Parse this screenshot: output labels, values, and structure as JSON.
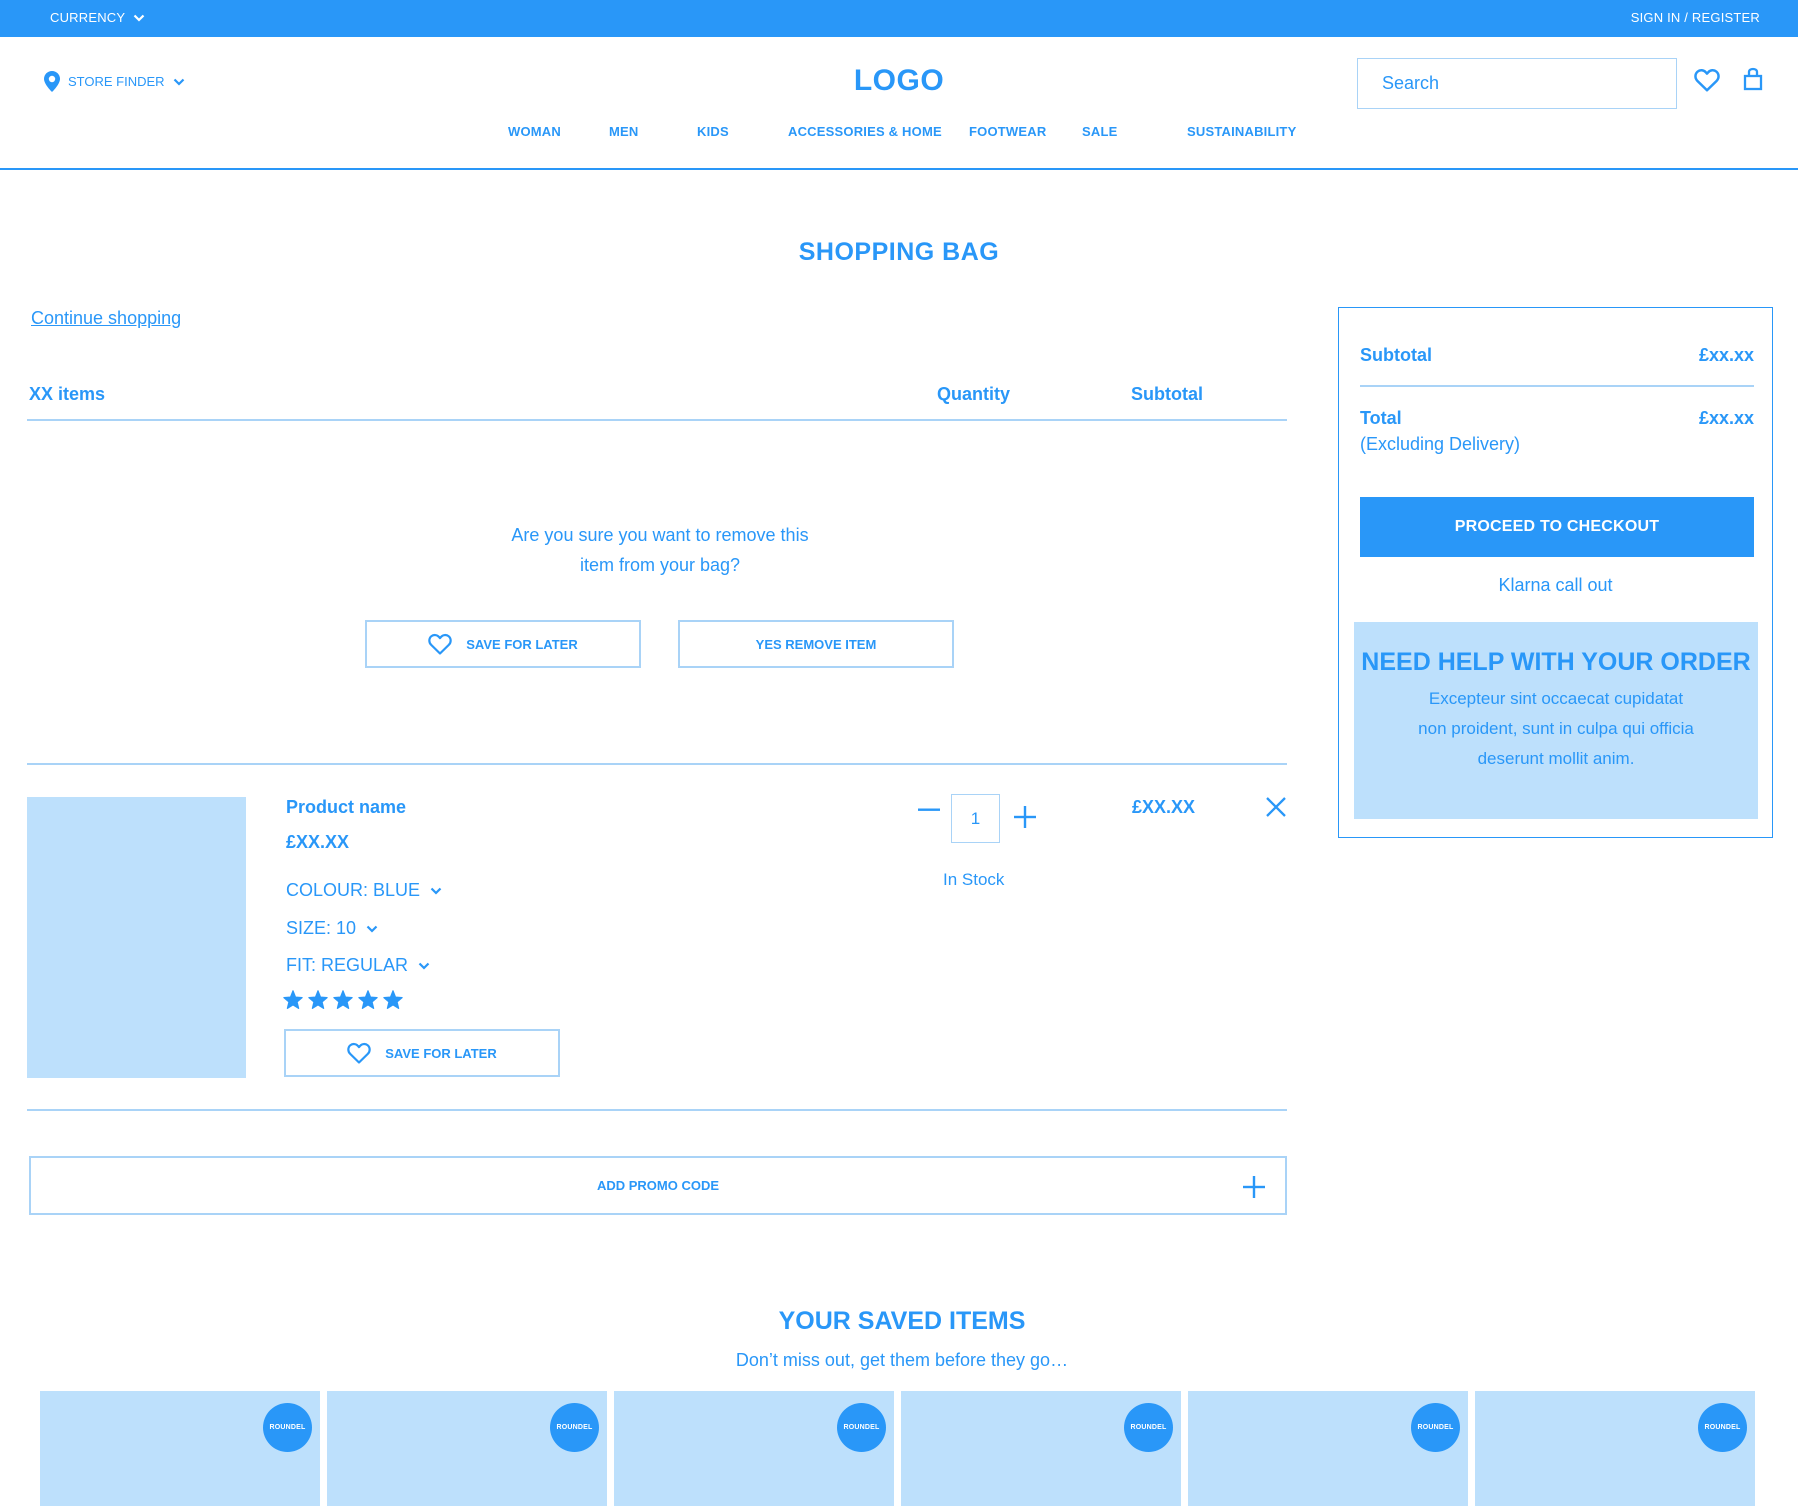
{
  "topbar": {
    "currency": "CURRENCY",
    "signin": "SIGN IN / REGISTER"
  },
  "header": {
    "store_finder": "STORE FINDER",
    "logo": "LOGO",
    "search_placeholder": "Search",
    "nav": [
      "WOMAN",
      "MEN",
      "KIDS",
      "ACCESSORIES & HOME",
      "FOOTWEAR",
      "SALE",
      "SUSTAINABILITY"
    ]
  },
  "page": {
    "title": "SHOPPING BAG",
    "continue": "Continue shopping"
  },
  "bag": {
    "count_label": "XX items",
    "quantity_label": "Quantity",
    "subtotal_label": "Subtotal",
    "confirm_text": "Are you sure you want to remove this item from your bag?",
    "save_for_later": "SAVE FOR LATER",
    "yes_remove": "YES REMOVE ITEM",
    "item": {
      "name": "Product name",
      "price": "£XX.XX",
      "colour": "COLOUR: BLUE",
      "size": "SIZE: 10",
      "fit": "FIT: REGULAR",
      "rating": 5,
      "qty": "1",
      "stock": "In Stock",
      "line_total": "£XX.XX",
      "save_for_later": "SAVE FOR LATER"
    },
    "promo": "ADD PROMO CODE"
  },
  "summary": {
    "subtotal_label": "Subtotal",
    "subtotal_value": "£xx.xx",
    "total_label": "Total",
    "total_note": "(Excluding Delivery)",
    "total_value": "£xx.xx",
    "checkout": "PROCEED TO CHECKOUT",
    "klarna": "Klarna call out",
    "help_title": "NEED HELP WITH YOUR ORDER",
    "help_text": "Excepteur sint occaecat cupidatat non proident, sunt in culpa qui officia deserunt mollit anim."
  },
  "saved": {
    "title": "YOUR SAVED ITEMS",
    "subtitle": "Don’t miss out, get them before they go…",
    "items": [
      {
        "roundel": "ROUNDEL"
      },
      {
        "roundel": "ROUNDEL"
      },
      {
        "roundel": "ROUNDEL"
      },
      {
        "roundel": "ROUNDEL"
      },
      {
        "roundel": "ROUNDEL"
      },
      {
        "roundel": "ROUNDEL"
      }
    ]
  },
  "colors": {
    "accent": "#2997f8",
    "light": "#bde0fc",
    "line": "#a9d3f7"
  }
}
